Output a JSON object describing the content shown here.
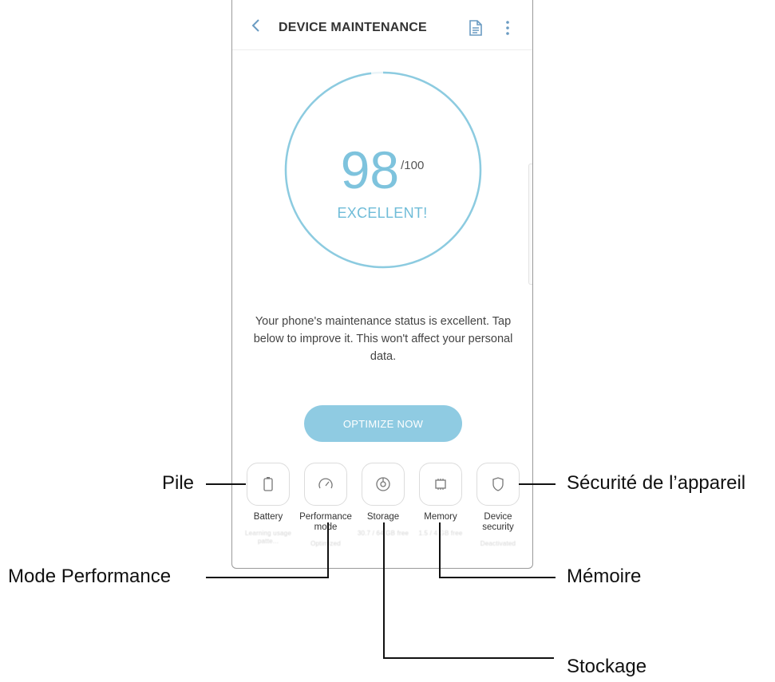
{
  "header": {
    "title": "DEVICE MAINTENANCE",
    "icons": [
      "chevron-left-icon",
      "document-icon",
      "more-vertical-icon"
    ]
  },
  "score": {
    "value": "98",
    "max": "/100",
    "level": 0.98,
    "status": "EXCELLENT!"
  },
  "message": "Your phone's maintenance status is excellent. Tap below to improve it. This won't affect your personal data.",
  "optimize_label": "OPTIMIZE NOW",
  "tools": [
    {
      "label": "Battery",
      "icon": "battery-icon",
      "sub": "Learning usage patte..."
    },
    {
      "label": "Performance mode",
      "icon": "gauge-icon",
      "sub": "Optimized"
    },
    {
      "label": "Storage",
      "icon": "storage-icon",
      "sub": "30.7 / 64 GB free"
    },
    {
      "label": "Memory",
      "icon": "memory-chip-icon",
      "sub": "1.5 / 4 GB free"
    },
    {
      "label": "Device security",
      "icon": "shield-icon",
      "sub": "Deactivated"
    }
  ],
  "callouts": {
    "battery": "Pile",
    "performance": "Mode Performance",
    "storage": "Stockage",
    "memory": "Mémoire",
    "security": "Sécurité de l’appareil"
  },
  "colors": {
    "accent": "#7ec3dd",
    "button": "#8fcbe2",
    "ring": "#8ccbe0"
  }
}
